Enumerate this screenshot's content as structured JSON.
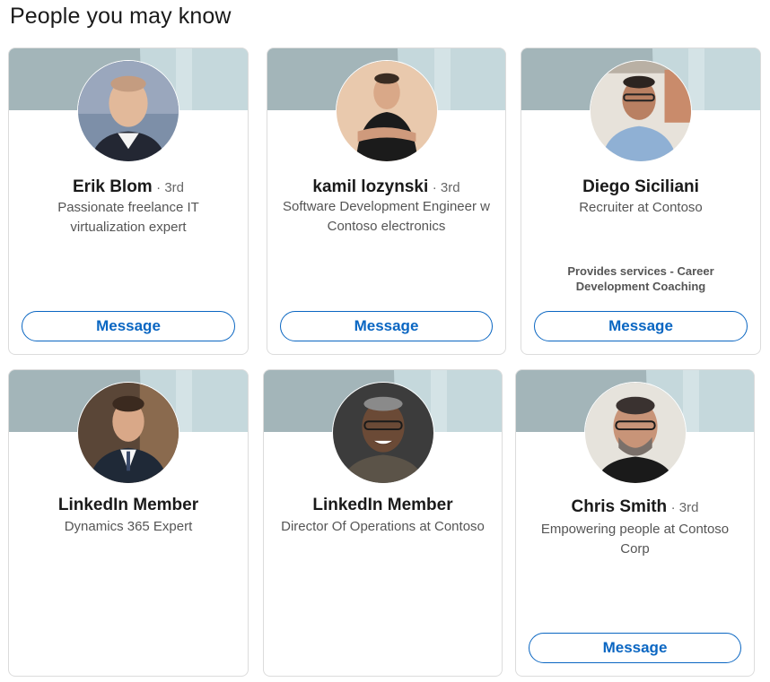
{
  "heading": "People you may know",
  "cards": [
    {
      "name": "Erik Blom",
      "degree": "· 3rd",
      "headline": "Passionate freelance IT virtualization expert",
      "services": "",
      "button": "Message",
      "avatar_icon": "person-photo-icon"
    },
    {
      "name": "kamil lozynski",
      "degree": "· 3rd",
      "headline": "Software Development Engineer w Contoso electronics",
      "services": "",
      "button": "Message",
      "avatar_icon": "person-photo-icon"
    },
    {
      "name": "Diego Siciliani",
      "degree": "",
      "headline": "Recruiter at Contoso",
      "services": "Provides services - Career Development Coaching",
      "button": "Message",
      "avatar_icon": "person-photo-icon"
    },
    {
      "name": "LinkedIn Member",
      "degree": "",
      "headline": "Dynamics 365 Expert",
      "services": "",
      "button": "",
      "avatar_icon": "person-photo-icon"
    },
    {
      "name": "LinkedIn Member",
      "degree": "",
      "headline": "Director Of Operations at Contoso",
      "services": "",
      "button": "",
      "avatar_icon": "person-photo-icon"
    },
    {
      "name": "Chris Smith",
      "degree": "· 3rd",
      "headline": "Empowering people at Contoso Corp",
      "services": "",
      "button": "Message",
      "avatar_icon": "person-photo-icon"
    }
  ],
  "colors": {
    "accent": "#0a66c2",
    "banner": "#b9cfd4",
    "banner_dark": "#a3b5b9"
  }
}
